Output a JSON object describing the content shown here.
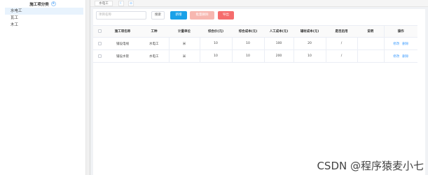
{
  "sidebar": {
    "title": "施工项分类",
    "add_icon": "+",
    "items": [
      {
        "label": "水电工"
      },
      {
        "label": "瓦工"
      },
      {
        "label": "木工"
      }
    ]
  },
  "tabs": [
    {
      "label": "水电工"
    },
    {
      "label": "☾"
    },
    {
      "label": "⊙"
    }
  ],
  "toolbar": {
    "search_placeholder": "项目名称",
    "search_label": "搜索",
    "add_label": "新增",
    "batch_delete_label": "批量删除",
    "export_label": "导出"
  },
  "table": {
    "headers": [
      "施工项名称",
      "工种",
      "计量单位",
      "综合价(元)",
      "综合成本(元)",
      "人工成本(元)",
      "辅材成本(元)",
      "是否启用",
      "说明",
      "操作"
    ],
    "rows": [
      {
        "name": "铺设电线",
        "trade": "水电工",
        "unit": "米",
        "price": "10",
        "cost": "10",
        "labor": "100",
        "aux": "20",
        "enabled": "/",
        "note": "",
        "edit": "修改",
        "delete": "删除"
      },
      {
        "name": "铺设水管",
        "trade": "水电工",
        "unit": "米",
        "price": "10",
        "cost": "10",
        "labor": "200",
        "aux": "10",
        "enabled": "/",
        "note": "",
        "edit": "修改",
        "delete": "删除"
      }
    ]
  },
  "watermark": "CSDN @程序猿麦小七",
  "colors": {
    "accent": "#409eff",
    "add": "#1aa1e8",
    "danger": "#f56c6c"
  }
}
